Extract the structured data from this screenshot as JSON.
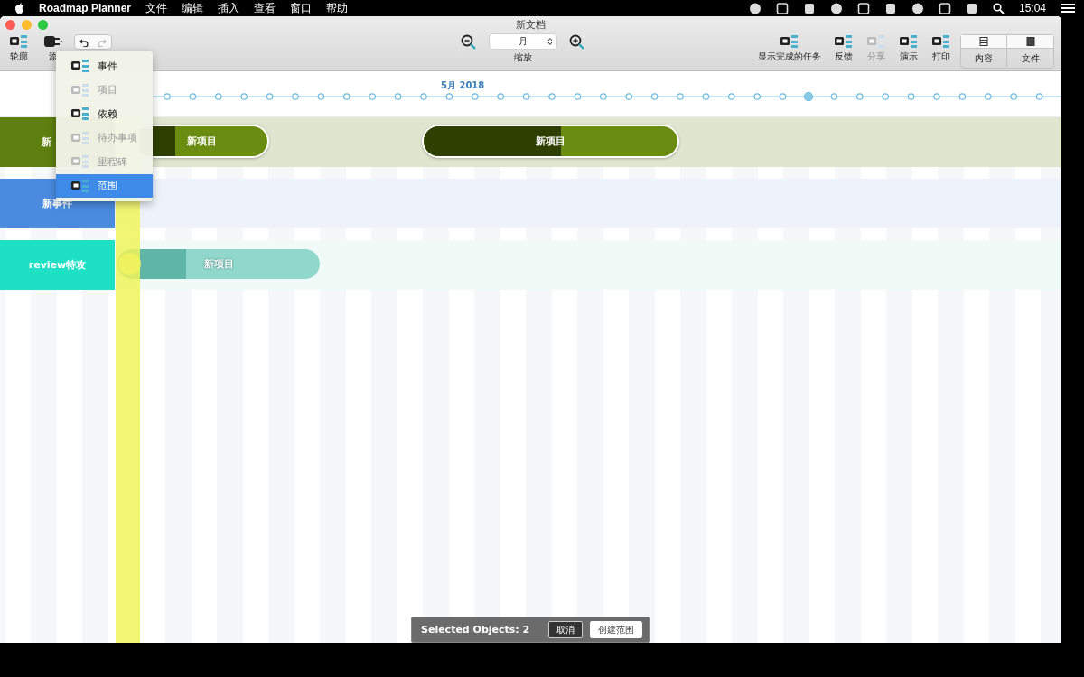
{
  "menu_bar": {
    "app_name": "Roadmap Planner",
    "menus": [
      "文件",
      "编辑",
      "插入",
      "查看",
      "窗口",
      "帮助"
    ],
    "clock": "15:04"
  },
  "window": {
    "title": "新文档"
  },
  "toolbar": {
    "left": [
      {
        "label": "轮廓",
        "kind": "outline"
      },
      {
        "label": "添",
        "kind": "add"
      }
    ],
    "undo_disabled": false,
    "redo_disabled": true,
    "zoom": {
      "value": "月",
      "label": "缩放"
    },
    "right": [
      {
        "label": "显示完成的任务",
        "disabled": false,
        "kind": "tasks"
      },
      {
        "label": "反馈",
        "disabled": false,
        "kind": "feedback"
      },
      {
        "label": "分享",
        "disabled": true,
        "kind": "share"
      },
      {
        "label": "演示",
        "disabled": false,
        "kind": "present"
      },
      {
        "label": "打印",
        "disabled": false,
        "kind": "print"
      }
    ],
    "view_tabs": [
      {
        "label": "内容",
        "selected": false
      },
      {
        "label": "文件",
        "selected": false
      }
    ]
  },
  "add_menu": [
    {
      "label": "事件",
      "disabled": false,
      "selected": false
    },
    {
      "label": "项目",
      "disabled": true,
      "selected": false
    },
    {
      "label": "依赖",
      "disabled": false,
      "selected": false
    },
    {
      "label": "待办事项",
      "disabled": true,
      "selected": false
    },
    {
      "label": "里程碑",
      "disabled": true,
      "selected": false
    },
    {
      "label": "范围",
      "disabled": false,
      "selected": true
    }
  ],
  "timeline": {
    "month": "5月 2018"
  },
  "lanes": [
    {
      "label": "新",
      "color": "#5d7f10",
      "bars": [
        {
          "label": "新项目",
          "level": 0.3,
          "dimmed": false
        },
        {
          "label": "新项目",
          "level": 0.54,
          "dimmed": false
        }
      ]
    },
    {
      "label": "新事件",
      "color": "#4a8be0"
    },
    {
      "label": "review特攻",
      "color": "#1ee0c4",
      "bars": [
        {
          "label": "新项目",
          "level": 0.34,
          "dimmed": true
        }
      ]
    }
  ],
  "selection_bar": {
    "text": "Selected Objects: 2",
    "cancel": "取消",
    "create": "创建范围"
  }
}
